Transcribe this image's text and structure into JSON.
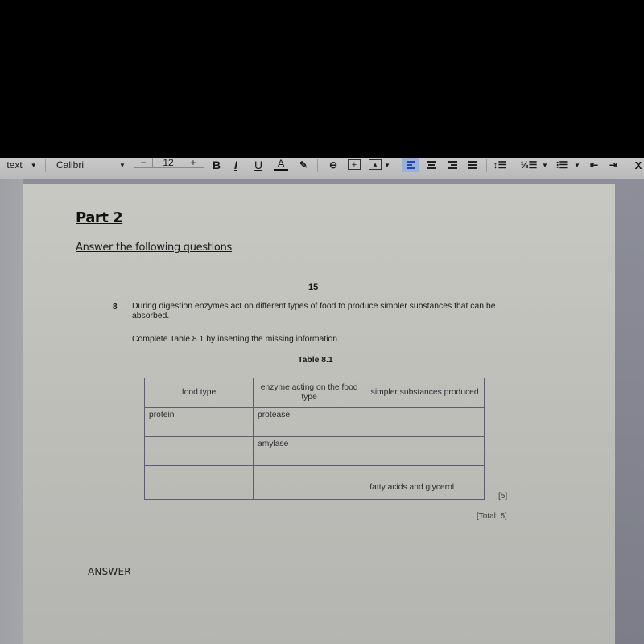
{
  "toolbar": {
    "style_select": "text",
    "font_select": "Calibri",
    "font_size": "12",
    "decrease_label": "−",
    "increase_label": "+",
    "bold": "B",
    "italic": "I",
    "underline": "U",
    "text_color": "A",
    "close_label": "X"
  },
  "document": {
    "heading": "Part 2",
    "instruction": "Answer the following questions",
    "page_number": "15",
    "question": {
      "number": "8",
      "text": "During digestion enzymes act on different types of food to produce simpler substances that can be absorbed.",
      "sub_instruction": "Complete Table 8.1 by inserting the missing information.",
      "table_caption": "Table 8.1",
      "table": {
        "headers": [
          "food type",
          "enzyme acting on the food type",
          "simpler substances produced"
        ],
        "rows": [
          [
            "protein",
            "protease",
            ""
          ],
          [
            "",
            "amylase",
            ""
          ],
          [
            "",
            "",
            "fatty acids and glycerol"
          ]
        ]
      },
      "marks": "[5]",
      "total": "[Total: 5]"
    },
    "answer_label": "ANSWER"
  }
}
